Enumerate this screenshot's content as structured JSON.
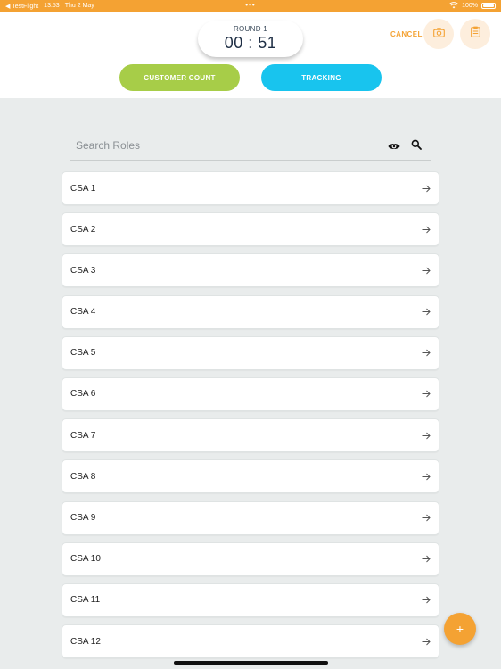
{
  "status_bar": {
    "back_app": "◀ TestFlight",
    "time": "13:53",
    "date": "Thu 2 May",
    "dots": "•••",
    "battery": "100%"
  },
  "timer": {
    "round_label": "ROUND 1",
    "value": "00 : 51"
  },
  "header": {
    "cancel_label": "CANCEL",
    "camera_icon": "camera-icon",
    "clipboard_icon": "clipboard-icon"
  },
  "tabs": {
    "customer_count": "CUSTOMER COUNT",
    "tracking": "TRACKING"
  },
  "search": {
    "placeholder": "Search Roles"
  },
  "roles": [
    {
      "name": "CSA 1"
    },
    {
      "name": "CSA 2"
    },
    {
      "name": "CSA 3"
    },
    {
      "name": "CSA 4"
    },
    {
      "name": "CSA 5"
    },
    {
      "name": "CSA 6"
    },
    {
      "name": "CSA 7"
    },
    {
      "name": "CSA 8"
    },
    {
      "name": "CSA 9"
    },
    {
      "name": "CSA 10"
    },
    {
      "name": "CSA 11"
    },
    {
      "name": "CSA 12"
    }
  ],
  "fab": {
    "label": "+"
  },
  "colors": {
    "accent": "#f4a233",
    "green": "#a7cd48",
    "blue": "#18c4ee",
    "background": "#e9ecec"
  }
}
